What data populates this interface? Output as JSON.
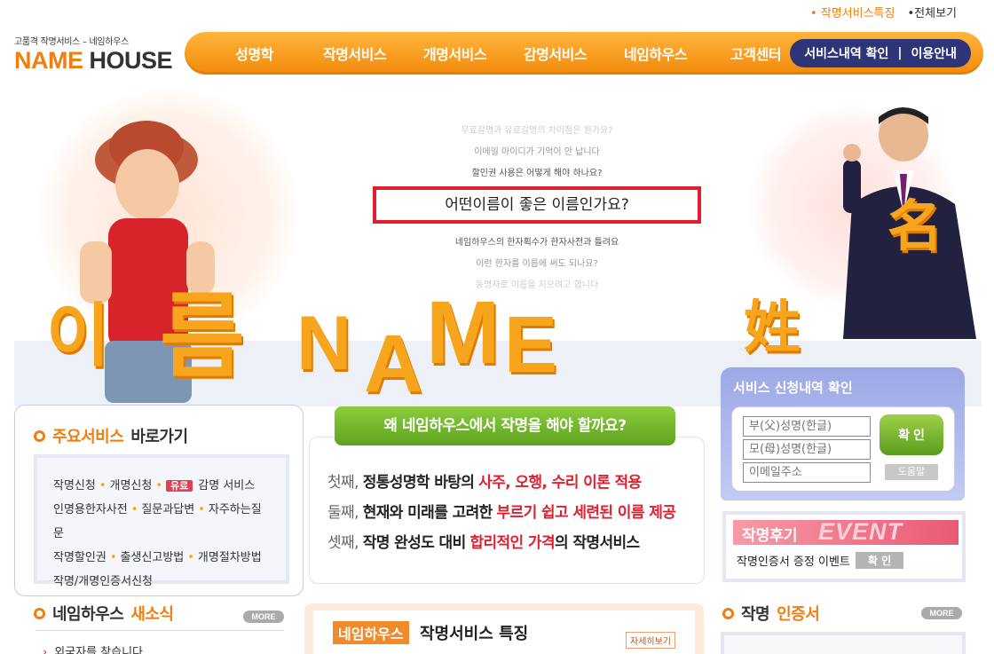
{
  "top_links": {
    "feature": "• 작명서비스특징",
    "sitemap": "•전체보기"
  },
  "logo": {
    "subtitle": "고품격 작명서비스 – 네임하우스",
    "name_part": "NAME",
    "house_part": "HOUSE",
    "brand_color": "#f07e10"
  },
  "nav": {
    "items": [
      "성명학",
      "작명서비스",
      "개명서비스",
      "감명서비스",
      "네임하우스",
      "고객센터"
    ],
    "pill_left": "서비스내역 확인",
    "pill_sep": "|",
    "pill_right": "이용안내"
  },
  "hero": {
    "questions_top": [
      "무료감명과 유료감명의 차이점은 뭔가요?",
      "이메일 아이디가 기억이 안 납니다",
      "할인권 사용은 어떻게 해야 하나요?"
    ],
    "highlight_question": "어떤이름이 좋은 이름인가요?",
    "questions_bottom": [
      "네임하우스의 한자획수가 한자사전과 틀려요",
      "이런 한자를 이름에 써도 되나요?",
      "동명자로 이름을 지으려고 합니다"
    ],
    "letters_korean": [
      "이",
      "름"
    ],
    "letters_name": [
      "N",
      "A",
      "M",
      "E"
    ],
    "hanja_surname": "姓",
    "hanja_second": "名"
  },
  "main_services": {
    "title_hl": "주요서비스",
    "title_rest": "바로가기",
    "row1": [
      "작명신청",
      "개명신청"
    ],
    "paid_badge": "유료",
    "row1_last": "감명 서비스",
    "row2": [
      "인명용한자사전",
      "질문과답변",
      "자주하는질문"
    ],
    "row3": [
      "작명할인권",
      "출생신고방법",
      "개명절차방법"
    ],
    "row4": "작명/개명인증서신청"
  },
  "why": {
    "title": "왜 네임하우스에서 작명을 해야 할까요?",
    "lines": [
      {
        "ord": "첫째,",
        "bold": "정통성명학 바탕의",
        "red": "사주, 오행, 수리 이론 적용",
        "tail": ""
      },
      {
        "ord": "둘째,",
        "bold": "현재와 미래를 고려한",
        "red": "부르기 쉽고 세련된 이름 제공",
        "tail": ""
      },
      {
        "ord": "셋째,",
        "bold": "작명 완성도 대비",
        "red": "합리적인 가격",
        "tail": "의 작명서비스"
      }
    ]
  },
  "service_check": {
    "title": "서비스 신청내역 확인",
    "father_placeholder": "부(父)성명(한글)",
    "mother_placeholder": "모(母)성명(한글)",
    "email_placeholder": "이메일주소",
    "confirm_label": "확 인",
    "help_label": "도움말"
  },
  "event": {
    "title": "작명후기",
    "title_event": "EVENT",
    "text": "작명인증서 증정 이벤트",
    "confirm_label": "확 인"
  },
  "news": {
    "title_plain": "네임하우스",
    "title_hl": "새소식",
    "more": "MORE",
    "first_item": "외국자를 찾습니다"
  },
  "feature": {
    "badge": "네임하우스",
    "title": "작명서비스 특징",
    "detail_btn": "자세히보기"
  },
  "cert": {
    "title_plain": "작명",
    "title_hl": "인증서",
    "more": "MORE"
  }
}
